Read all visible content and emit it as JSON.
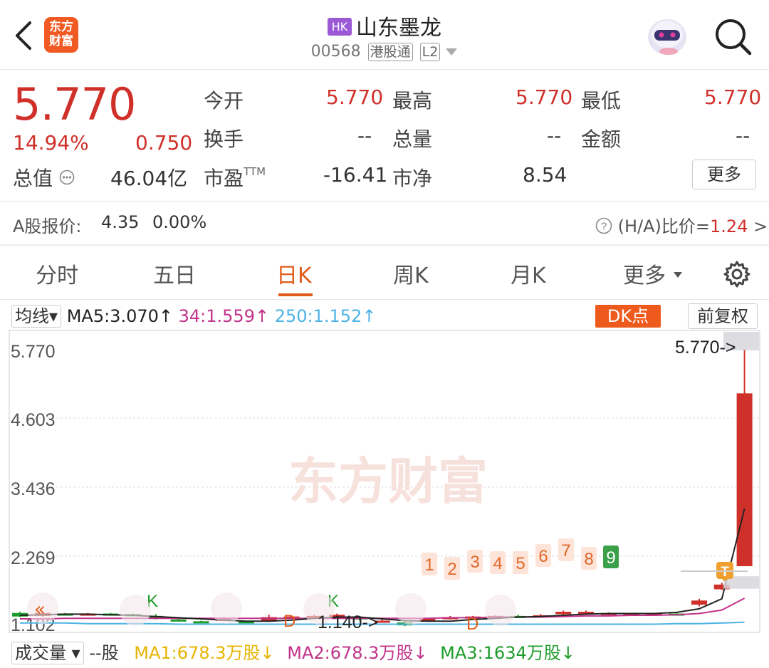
{
  "header": {
    "back_icon": "chevron-left-icon",
    "logo_line1": "东方",
    "logo_line2": "财富",
    "badge": "HK",
    "stock_name": "山东墨龙",
    "stock_code": "00568",
    "tag_connect": "港股通",
    "tag_level": "L2"
  },
  "quote": {
    "price": "5.770",
    "change_pct": "14.94%",
    "change_amt": "0.750",
    "mkt_cap_label": "总值",
    "mkt_cap": "46.04亿",
    "open_label": "今开",
    "open": "5.770",
    "high_label": "最高",
    "high": "5.770",
    "low_label": "最低",
    "low": "5.770",
    "turnover_label": "换手",
    "turnover": "--",
    "volume_label": "总量",
    "volume": "--",
    "amount_label": "金额",
    "amount": "--",
    "pe_label": "市盈",
    "pe_sup": "TTM",
    "pe": "-16.41",
    "pb_label": "市净",
    "pb": "8.54",
    "more": "更多"
  },
  "ashare": {
    "label": "A股报价:",
    "price": "4.35",
    "pct": "0.00%",
    "ratio_label": "(H/A)比价=",
    "ratio": "1.24",
    "arrow": ">"
  },
  "tabs": [
    "分时",
    "五日",
    "日K",
    "周K",
    "月K",
    "更多"
  ],
  "active_tab": "日K",
  "chart_toolbar": {
    "ma_type": "均线",
    "ma5": "MA5:3.070",
    "ma34": "34:1.559",
    "ma250": "250:1.152",
    "dk": "DK点",
    "adjust": "前复权"
  },
  "colors": {
    "up": "#d0302a",
    "down": "#1e9c2a",
    "accent": "#e05c1a",
    "ma5": "#222222",
    "ma34": "#c2338a",
    "ma250": "#4db3e6"
  },
  "chart_data": {
    "type": "candlestick",
    "y_ticks": [
      "5.770",
      "4.603",
      "3.436",
      "2.269",
      "1.102"
    ],
    "ylim": [
      1.102,
      5.77
    ],
    "last_price_label": "5.770->",
    "low_marker_label": "1.140->",
    "watermark": "东方财富",
    "markers": [
      "K",
      "D",
      "K",
      "D",
      "T"
    ],
    "count_labels": [
      "1",
      "2",
      "3",
      "4",
      "5",
      "6",
      "7",
      "8",
      "9"
    ],
    "candles": [
      {
        "o": 1.31,
        "c": 1.25,
        "h": 1.33,
        "l": 1.24
      },
      {
        "o": 1.26,
        "c": 1.31,
        "h": 1.33,
        "l": 1.25
      },
      {
        "o": 1.3,
        "c": 1.28,
        "h": 1.31,
        "l": 1.27
      },
      {
        "o": 1.29,
        "c": 1.3,
        "h": 1.31,
        "l": 1.28
      },
      {
        "o": 1.3,
        "c": 1.29,
        "h": 1.31,
        "l": 1.28
      },
      {
        "o": 1.29,
        "c": 1.28,
        "h": 1.3,
        "l": 1.27
      },
      {
        "o": 1.26,
        "c": 1.22,
        "h": 1.29,
        "l": 1.2
      },
      {
        "o": 1.2,
        "c": 1.19,
        "h": 1.21,
        "l": 1.18
      },
      {
        "o": 1.17,
        "c": 1.15,
        "h": 1.18,
        "l": 1.14
      },
      {
        "o": 1.2,
        "c": 1.21,
        "h": 1.24,
        "l": 1.19
      },
      {
        "o": 1.17,
        "c": 1.15,
        "h": 1.18,
        "l": 1.14
      },
      {
        "o": 1.17,
        "c": 1.24,
        "h": 1.28,
        "l": 1.16
      },
      {
        "o": 1.25,
        "c": 1.25,
        "h": 1.27,
        "l": 1.23
      },
      {
        "o": 1.26,
        "c": 1.26,
        "h": 1.28,
        "l": 1.25
      },
      {
        "o": 1.27,
        "c": 1.28,
        "h": 1.3,
        "l": 1.26
      },
      {
        "o": 1.24,
        "c": 1.2,
        "h": 1.26,
        "l": 1.18
      },
      {
        "o": 1.18,
        "c": 1.18,
        "h": 1.2,
        "l": 1.16
      },
      {
        "o": 1.15,
        "c": 1.1,
        "h": 1.17,
        "l": 1.09
      },
      {
        "o": 1.2,
        "c": 1.21,
        "h": 1.22,
        "l": 1.19
      },
      {
        "o": 1.21,
        "c": 1.24,
        "h": 1.26,
        "l": 1.2
      },
      {
        "o": 1.25,
        "c": 1.25,
        "h": 1.26,
        "l": 1.24
      },
      {
        "o": 1.23,
        "c": 1.26,
        "h": 1.27,
        "l": 1.21
      },
      {
        "o": 1.26,
        "c": 1.25,
        "h": 1.28,
        "l": 1.23
      },
      {
        "o": 1.25,
        "c": 1.27,
        "h": 1.29,
        "l": 1.24
      },
      {
        "o": 1.29,
        "c": 1.33,
        "h": 1.35,
        "l": 1.28
      },
      {
        "o": 1.33,
        "c": 1.33,
        "h": 1.35,
        "l": 1.31
      },
      {
        "o": 1.28,
        "c": 1.31,
        "h": 1.32,
        "l": 1.27
      },
      {
        "o": 1.3,
        "c": 1.3,
        "h": 1.31,
        "l": 1.29
      },
      {
        "o": 1.28,
        "c": 1.3,
        "h": 1.3,
        "l": 1.27
      },
      {
        "o": 1.3,
        "c": 1.28,
        "h": 1.31,
        "l": 1.27
      },
      {
        "o": 1.45,
        "c": 1.52,
        "h": 1.55,
        "l": 1.42
      },
      {
        "o": 1.71,
        "c": 1.79,
        "h": 1.82,
        "l": 1.7
      },
      {
        "o": 2.1,
        "c": 5.02,
        "h": 5.77,
        "l": 2.1
      }
    ],
    "ma5": [
      1.27,
      1.28,
      1.29,
      1.29,
      1.28,
      1.27,
      1.25,
      1.23,
      1.21,
      1.19,
      1.17,
      1.17,
      1.19,
      1.22,
      1.24,
      1.24,
      1.21,
      1.18,
      1.17,
      1.17,
      1.2,
      1.22,
      1.24,
      1.25,
      1.27,
      1.29,
      1.3,
      1.3,
      1.3,
      1.32,
      1.38,
      1.55,
      3.07
    ],
    "ma34": [
      1.21,
      1.21,
      1.22,
      1.22,
      1.22,
      1.22,
      1.22,
      1.22,
      1.22,
      1.22,
      1.22,
      1.22,
      1.22,
      1.22,
      1.22,
      1.22,
      1.22,
      1.22,
      1.22,
      1.23,
      1.23,
      1.24,
      1.24,
      1.24,
      1.25,
      1.26,
      1.26,
      1.27,
      1.27,
      1.28,
      1.3,
      1.36,
      1.559
    ],
    "ma250": [
      1.14,
      1.14,
      1.14,
      1.13,
      1.13,
      1.13,
      1.13,
      1.12,
      1.12,
      1.12,
      1.12,
      1.12,
      1.12,
      1.12,
      1.12,
      1.12,
      1.12,
      1.12,
      1.12,
      1.12,
      1.12,
      1.12,
      1.12,
      1.12,
      1.12,
      1.12,
      1.12,
      1.12,
      1.12,
      1.13,
      1.13,
      1.14,
      1.152
    ]
  },
  "volume_bar": {
    "type_label": "成交量",
    "unit": "--股",
    "ma1": "MA1:678.3万股",
    "ma2": "MA2:678.3万股",
    "ma3": "MA3:1634万股"
  }
}
